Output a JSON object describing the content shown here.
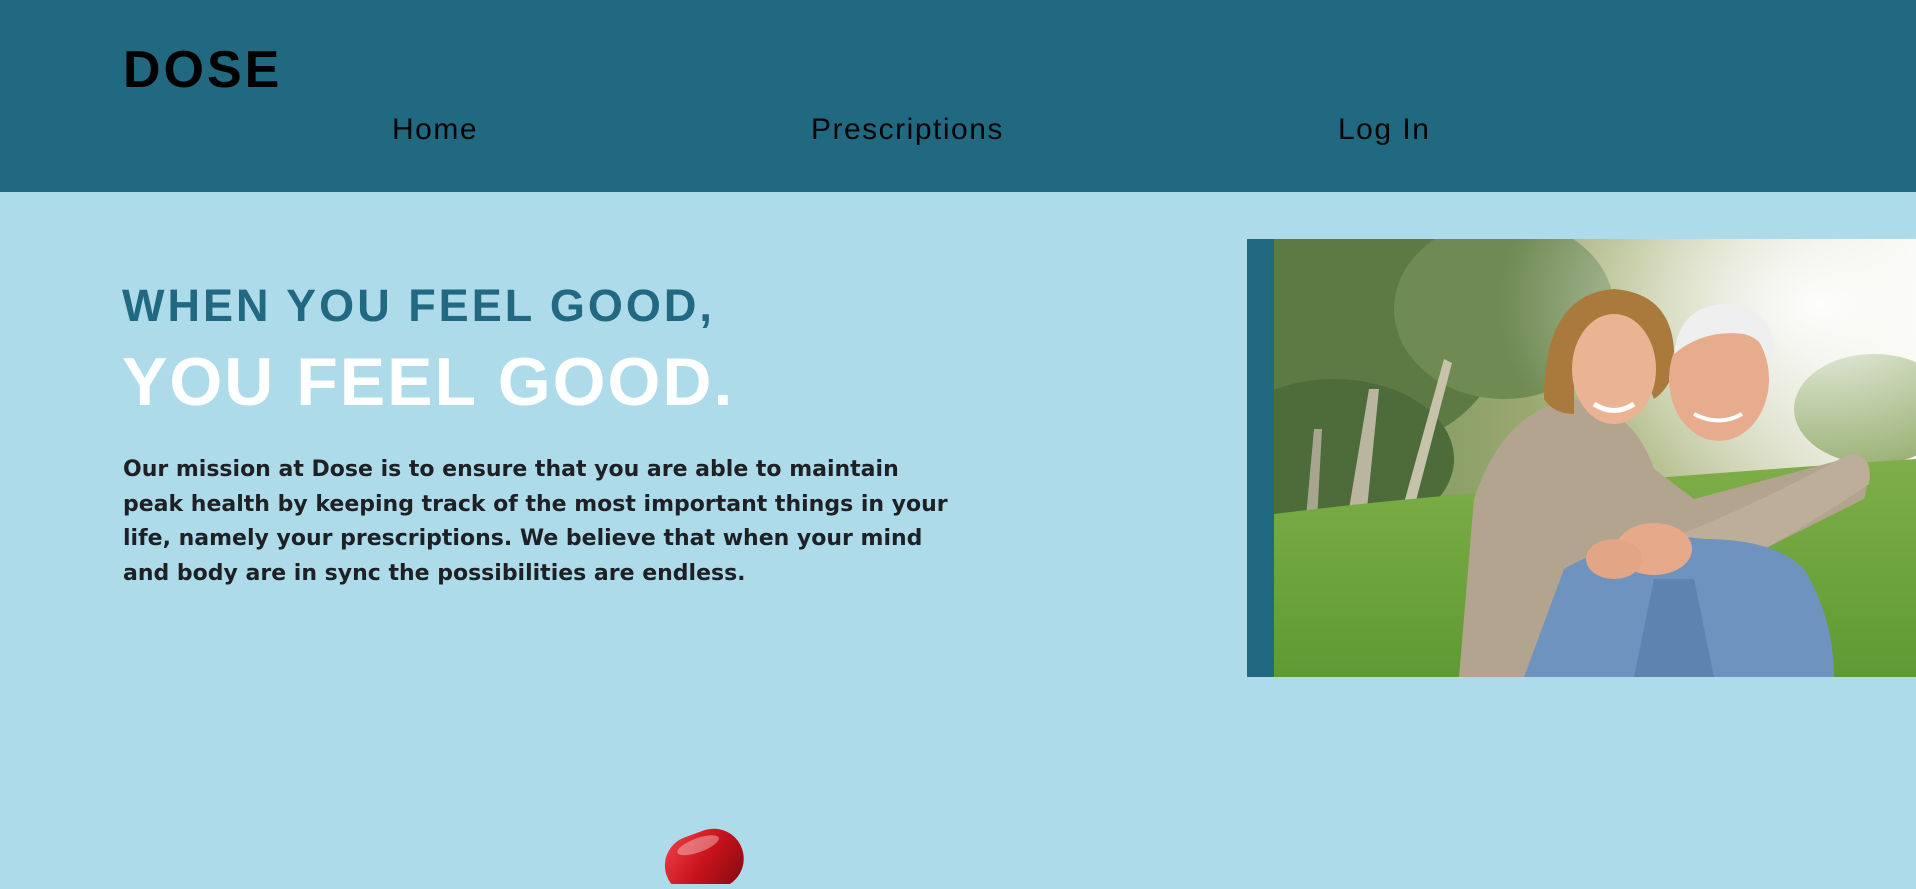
{
  "header": {
    "logo": "DOSE",
    "nav": [
      {
        "label": "Home"
      },
      {
        "label": "Prescriptions"
      },
      {
        "label": "Log In"
      }
    ]
  },
  "hero": {
    "headline_line1": "WHEN YOU FEEL GOOD,",
    "headline_line2": "YOU FEEL GOOD.",
    "mission": "Our mission at Dose is to ensure that you are able to maintain peak health by keeping track of the most important things in your life, namely your prescriptions. We believe that when your mind and body are in sync the possibilities are endless."
  },
  "colors": {
    "header_bg": "#216980",
    "page_bg": "#addbea",
    "headline_accent": "#216980",
    "headline_white": "#ffffff",
    "body_text": "#1d2126",
    "pill_red": "#c8121b"
  },
  "images": {
    "hero_photo": "smiling-senior-couple-photo",
    "pill": "red-capsule-image"
  }
}
